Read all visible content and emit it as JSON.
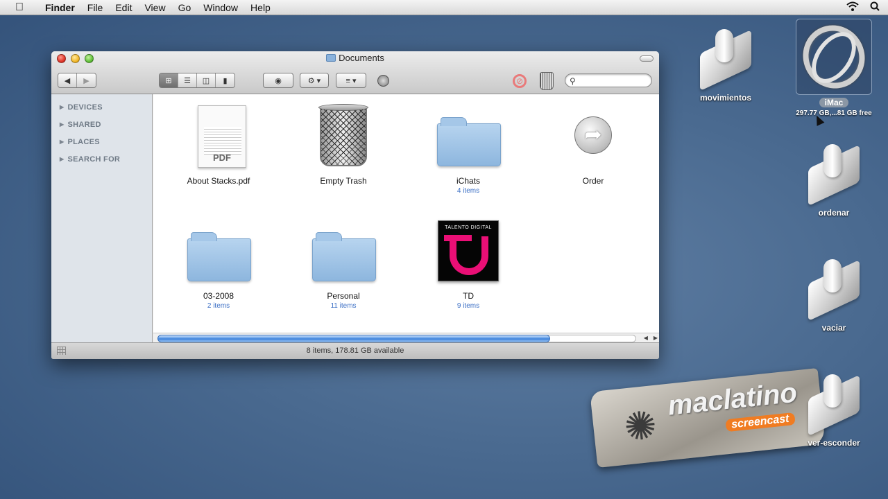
{
  "menubar": {
    "apple_icon": "apple-icon",
    "items": [
      "Finder",
      "File",
      "Edit",
      "View",
      "Go",
      "Window",
      "Help"
    ],
    "right_icons": [
      "wifi-icon",
      "spotlight-icon"
    ]
  },
  "window": {
    "title": "Documents",
    "toolbar": {
      "view_modes": [
        "icon-view",
        "list-view",
        "column-view",
        "coverflow-view"
      ],
      "active_view": "icon-view",
      "search_placeholder": ""
    },
    "sidebar": {
      "sections": [
        "DEVICES",
        "SHARED",
        "PLACES",
        "SEARCH FOR"
      ]
    },
    "items": [
      {
        "name": "About Stacks.pdf",
        "sub": "",
        "kind": "pdf"
      },
      {
        "name": "Empty Trash",
        "sub": "",
        "kind": "trash"
      },
      {
        "name": "iChats",
        "sub": "4 items",
        "kind": "folder"
      },
      {
        "name": "Order",
        "sub": "",
        "kind": "app"
      },
      {
        "name": "03-2008",
        "sub": "2 items",
        "kind": "folder"
      },
      {
        "name": "Personal",
        "sub": "11 items",
        "kind": "folder"
      },
      {
        "name": "TD",
        "sub": "9 items",
        "kind": "image"
      }
    ],
    "pdf_tag": "PDF",
    "td_icon_text": "TALENTO DIGITAL",
    "status": "8 items, 178.81 GB available",
    "hscroll_fraction": 0.82
  },
  "desktop": {
    "imac": {
      "label": "iMac",
      "sub": "297.77 GB,...81 GB free"
    },
    "icons": [
      "movimientos",
      "ordenar",
      "vaciar",
      "ver-esconder"
    ]
  },
  "watermark": {
    "main": "maclatino",
    "sub": "screencast"
  }
}
